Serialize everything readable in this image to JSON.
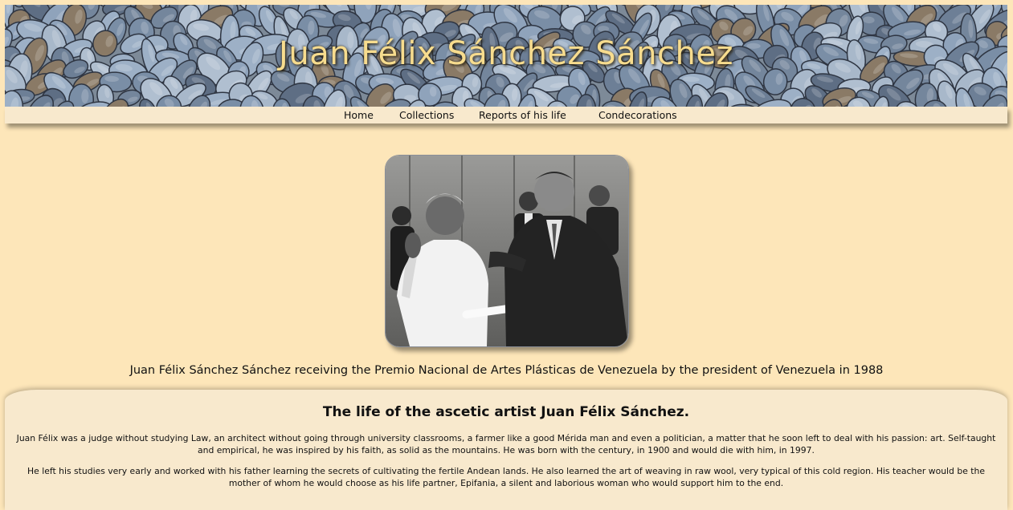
{
  "header": {
    "title": "Juan Félix Sánchez Sánchez"
  },
  "nav": {
    "items": [
      {
        "label": "Home"
      },
      {
        "label": "Collections"
      },
      {
        "label": "Reports of his life"
      },
      {
        "label": "Condecorations"
      }
    ]
  },
  "photo": {
    "caption": "Juan Félix Sánchez Sánchez receiving the Premio Nacional de Artes Plásticas de Venezuela by the president of Venezuela in 1988"
  },
  "article": {
    "heading": "The life of the ascetic artist Juan Félix Sánchez.",
    "paragraphs": [
      "Juan Félix was a judge without studying Law, an architect without going through university classrooms, a farmer like a good Mérida man and even a politician, a matter that he soon left to deal with his passion: art. Self-taught and empirical, he was inspired by his faith, as solid as the mountains. He was born with the century, in 1900 and would die with him, in 1997.",
      "He left his studies very early and worked with his father learning the secrets of cultivating the fertile Andean lands. He also learned the art of weaving in raw wool, very typical of this cold region. His teacher would be the mother of whom he would choose as his life partner, Epifania, a silent and laborious woman who would support him to the end."
    ]
  },
  "colors": {
    "page_background": "#fde6b9",
    "panel_background": "#f8e9cd",
    "title_color": "#f7dc8e"
  }
}
